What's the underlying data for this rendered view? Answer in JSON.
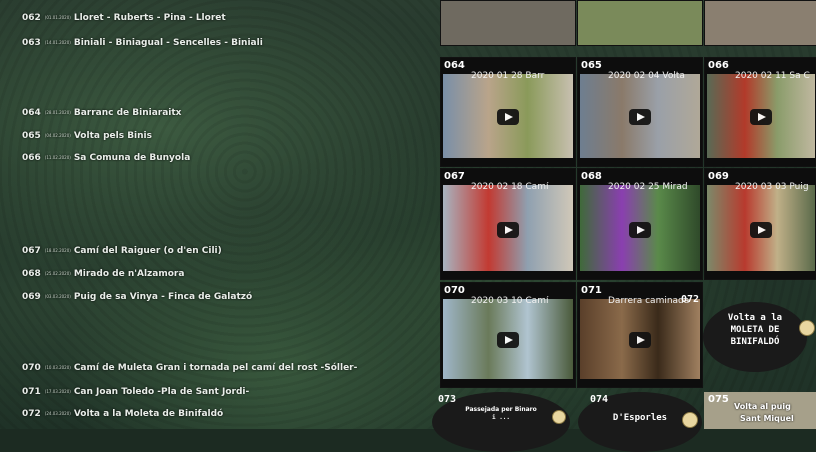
{
  "list": [
    {
      "num": "062",
      "date": "(01.01.2020)",
      "title": "Lloret - Ruberts - Pina - Lloret"
    },
    {
      "num": "063",
      "date": "(14.01.2020)",
      "title": "Biniali - Biniagual - Sencelles - Biniali"
    },
    {
      "num": "064",
      "date": "(28.01.2020)",
      "title": "Barranc de Biniaraitx"
    },
    {
      "num": "065",
      "date": "(04.02.2020)",
      "title": "Volta pels Binis"
    },
    {
      "num": "066",
      "date": "(11.02.2020)",
      "title": "Sa Comuna de Bunyola"
    },
    {
      "num": "067",
      "date": "(18.02.2020)",
      "title": "Camí del Raiguer (o d'en Cili)"
    },
    {
      "num": "068",
      "date": "(25.02.2020)",
      "title": "Mirado de n'Alzamora"
    },
    {
      "num": "069",
      "date": "(03.03.2020)",
      "title": "Puig de sa Vinya - Finca de Galatzó"
    },
    {
      "num": "070",
      "date": "(10.03.2020)",
      "title": "Camí de Muleta Gran i tornada pel camí del rost -Sóller-"
    },
    {
      "num": "071",
      "date": "(17.03.2020)",
      "title": "Can Joan Toledo -Pla de Sant Jordi-"
    },
    {
      "num": "072",
      "date": "(24.03.2020)",
      "title": "Volta a la Moleta de Binifaldó"
    }
  ],
  "tiles": [
    {
      "num": "064",
      "title": "2020 01 28 Barr",
      "colors": [
        "#7a8fa8",
        "#b9a48a",
        "#8a9a5a",
        "#c8c0b0"
      ]
    },
    {
      "num": "065",
      "title": "2020 02 04 Volta",
      "colors": [
        "#6e7e90",
        "#8a7a6a",
        "#9aa0a8",
        "#b0a898"
      ]
    },
    {
      "num": "066",
      "title": "2020 02 11 Sa C",
      "colors": [
        "#596a55",
        "#b23a2a",
        "#8a9c6a",
        "#c0b8a0"
      ]
    },
    {
      "num": "067",
      "title": "2020 02 18 Camí",
      "colors": [
        "#a8b4c0",
        "#c23a32",
        "#8fa0b0",
        "#d0c8b8"
      ]
    },
    {
      "num": "068",
      "title": "2020 02 25 Mirad",
      "colors": [
        "#3f6a3a",
        "#8a3fb0",
        "#5a8a4a",
        "#2f4a2a"
      ]
    },
    {
      "num": "069",
      "title": "2020 03 03 Puig",
      "colors": [
        "#7c8a6a",
        "#b83a2e",
        "#c0b088",
        "#5a6a4a"
      ]
    },
    {
      "num": "070",
      "title": "2020 03 10 Camí",
      "colors": [
        "#9fb6c8",
        "#6a7a5a",
        "#b0c4d0",
        "#4a5a3a"
      ]
    },
    {
      "num": "071",
      "title": "Darrera caminada",
      "colors": [
        "#5a3f2a",
        "#8a6a4a",
        "#3a2a1a",
        "#a08060"
      ]
    }
  ],
  "card072": {
    "num": "072",
    "line1": "Volta a la",
    "line2": "MOLETA DE",
    "line3": "BINIFALDÓ"
  },
  "card073": {
    "num": "073",
    "line1": "Passejada per Binaro",
    "line2": "i ..."
  },
  "card074": {
    "num": "074",
    "line1": "D'Esporles"
  },
  "card075": {
    "num": "075",
    "line1": "Volta al puig",
    "line2": "Sant Miquel"
  },
  "colors": {
    "tile_bg": "#0d0d0d",
    "text": "#e9eee9",
    "oval": "#1a1a1a"
  }
}
